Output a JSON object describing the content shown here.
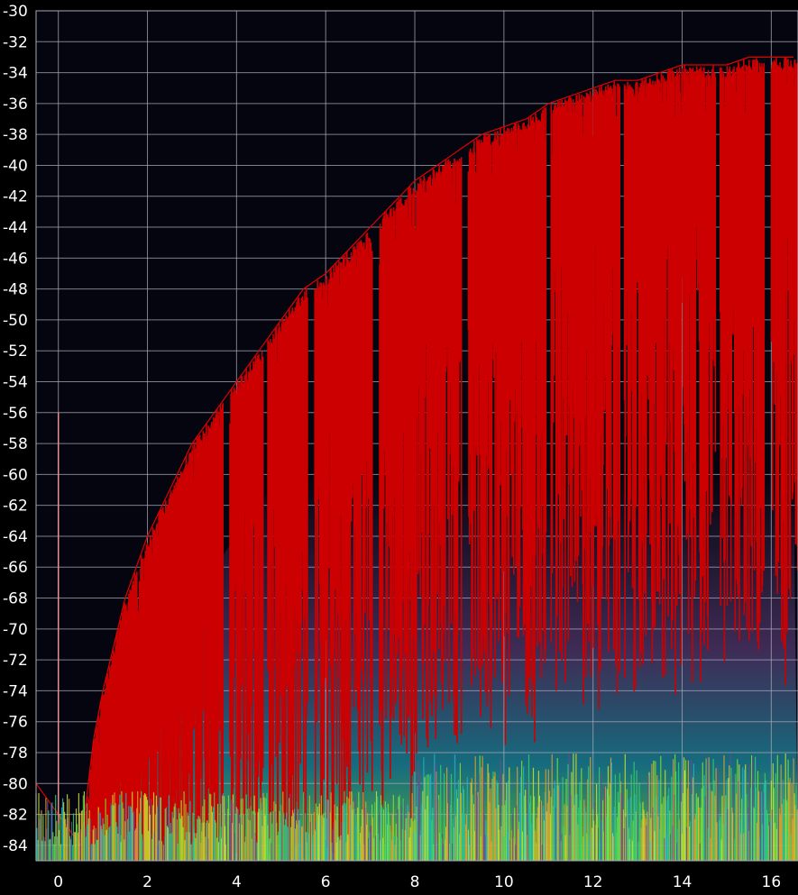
{
  "chart_data": {
    "type": "area",
    "title": "",
    "xlabel": "",
    "ylabel": "",
    "xlim": [
      -0.5,
      16.6
    ],
    "ylim": [
      -85,
      -30
    ],
    "grid": true,
    "x_ticks": [
      0,
      2,
      4,
      6,
      8,
      10,
      12,
      14,
      16
    ],
    "x_tick_labels": [
      "0",
      "2",
      "4",
      "6",
      "8",
      "10",
      "12",
      "14",
      "16"
    ],
    "y_ticks": [
      -30,
      -32,
      -34,
      -36,
      -38,
      -40,
      -42,
      -44,
      -46,
      -48,
      -50,
      -52,
      -54,
      -56,
      -58,
      -60,
      -62,
      -64,
      -66,
      -68,
      -70,
      -72,
      -74,
      -76,
      -78,
      -80,
      -82,
      -84
    ],
    "y_tick_labels": [
      "-30",
      "-32",
      "-34",
      "-36",
      "-38",
      "-40",
      "-42",
      "-44",
      "-46",
      "-48",
      "-50",
      "-52",
      "-54",
      "-56",
      "-58",
      "-60",
      "-62",
      "-64",
      "-66",
      "-68",
      "-70",
      "-72",
      "-74",
      "-76",
      "-78",
      "-80",
      "-82",
      "-84"
    ],
    "series": [
      {
        "x": [
          -0.5,
          0.5,
          0.8,
          1.0,
          1.5,
          2.0,
          2.5,
          3.0,
          3.5,
          4.0,
          4.5,
          5.0,
          5.5,
          6.0,
          6.5,
          7.0,
          7.5,
          8.0,
          8.5,
          9.0,
          9.5,
          10.0,
          10.5,
          11.0,
          11.5,
          12.0,
          12.5,
          13.0,
          13.5,
          14.0,
          14.5,
          15.0,
          15.5,
          16.0,
          16.5
        ],
        "y": [
          -80,
          -84,
          -77,
          -74,
          -68,
          -64,
          -61,
          -58,
          -56,
          -54,
          -52,
          -50,
          -48,
          -47,
          -45.5,
          -44,
          -42.5,
          -41,
          -40,
          -39,
          -38,
          -37.5,
          -37,
          -36,
          -35.5,
          -35,
          -34.5,
          -34.5,
          -34,
          -33.5,
          -33.5,
          -33.5,
          -33,
          -33,
          -33
        ]
      }
    ],
    "colors": {
      "background": "#000000",
      "plot_area": "#05050f",
      "grid": "#a8a8b8",
      "peak_fill": "#cc0000",
      "mid_density": "#6e4a8e",
      "high_density": "#7fe030",
      "cyan_density": "#21b0c8"
    }
  }
}
